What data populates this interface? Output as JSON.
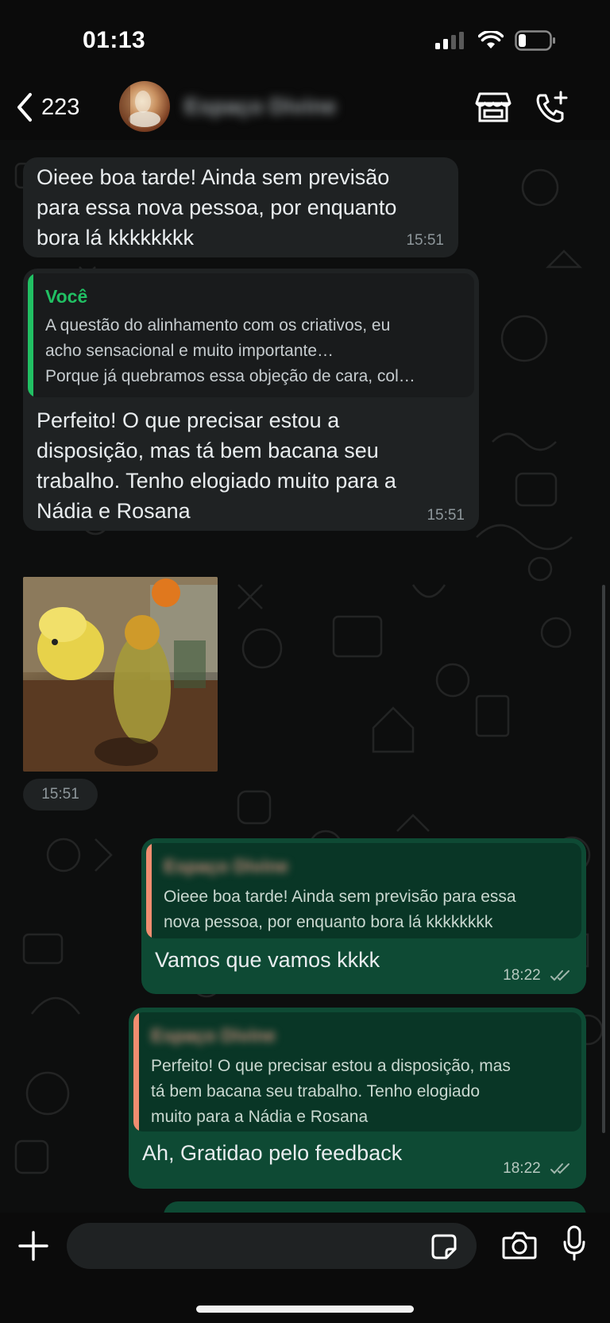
{
  "status_bar": {
    "time": "01:13"
  },
  "header": {
    "back_count": "223",
    "contact_name": "Espaço Divine"
  },
  "messages": [
    {
      "direction": "in",
      "text_lines": [
        "Oieee boa tarde! Ainda sem previsão",
        "para essa nova pessoa, por enquanto",
        "bora lá kkkkkkkk"
      ],
      "time": "15:51"
    },
    {
      "direction": "in",
      "quote": {
        "author": "Você",
        "lines": [
          "A questão do alinhamento com os criativos, eu",
          "acho sensacional e muito importante…",
          "Porque já quebramos essa objeção de cara, col…"
        ]
      },
      "text_lines": [
        "Perfeito! O que precisar estou a",
        "disposição, mas tá bem bacana seu",
        "trabalho. Tenho elogiado muito para a",
        "Nádia e Rosana"
      ],
      "time": "15:51"
    },
    {
      "direction": "in",
      "type": "image",
      "time": "15:51"
    },
    {
      "direction": "out",
      "quote": {
        "author": "Espaço Divine",
        "lines": [
          "Oieee boa tarde! Ainda sem previsão para essa",
          "nova pessoa, por enquanto bora lá kkkkkkkk"
        ]
      },
      "text": "Vamos que vamos kkkk",
      "time": "18:22",
      "status": "read"
    },
    {
      "direction": "out",
      "quote": {
        "author": "Espaço Divine",
        "lines": [
          "Perfeito! O que precisar estou a disposição, mas",
          "tá bem bacana seu trabalho. Tenho elogiado",
          "muito para a Nádia e Rosana"
        ]
      },
      "text": "Ah, Gratidao pelo feedback",
      "time": "18:22",
      "status": "read"
    }
  ],
  "composer": {
    "placeholder": ""
  },
  "colors": {
    "incoming_bubble": "#1f2223",
    "outgoing_bubble": "#0e4a34",
    "quote_self_accent": "#21c063",
    "quote_contact_accent": "#f08d70",
    "read_ticks": "#9fb5ab"
  },
  "icons": [
    "back-chevron-icon",
    "store-icon",
    "add-call-icon",
    "plus-icon",
    "sticker-icon",
    "camera-icon",
    "mic-icon",
    "signal-icon",
    "wifi-icon",
    "battery-icon"
  ]
}
